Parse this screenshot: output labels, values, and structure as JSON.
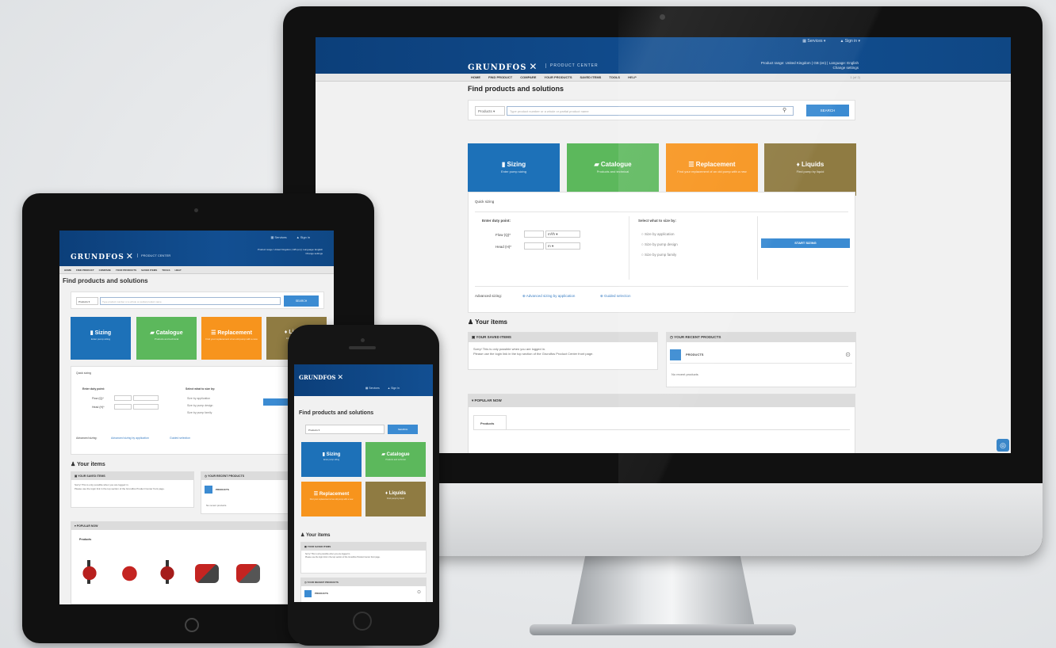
{
  "brand": {
    "logo": "GRUNDFOS",
    "logo_mark": "✕",
    "product_center": "PRODUCT CENTER"
  },
  "header": {
    "services": "Services",
    "sign_in": "Sign in",
    "range_line1": "Product range: United Kingdom | GB (en) | Language: English",
    "range_line2": "Change settings"
  },
  "nav": [
    "HOME",
    "FIND PRODUCT",
    "COMPARE",
    "YOUR PRODUCTS",
    "SAVED ITEMS",
    "TOOLS",
    "HELP"
  ],
  "nav_right": "1 (of 2)",
  "find": {
    "title": "Find products and solutions",
    "select_value": "Products",
    "placeholder": "Type product number or a whole or partial product name",
    "search_button": "SEARCH"
  },
  "tiles": [
    {
      "name": "Sizing",
      "icon": "ruler-icon",
      "sub": "Enter pump sizing",
      "color": "#1d71b8"
    },
    {
      "name": "Catalogue",
      "icon": "book-icon",
      "sub": "Products and technical",
      "color": "#5cb85c"
    },
    {
      "name": "Replacement",
      "icon": "swap-icon",
      "sub": "Find your replacement of an old pump with a new",
      "color": "#f7941d"
    },
    {
      "name": "Liquids",
      "icon": "drop-icon",
      "sub": "Find pump by liquid",
      "color": "#8f7b42"
    }
  ],
  "quick": {
    "title": "Quick sizing",
    "duty_title": "Enter duty point:",
    "flow_label": "Flow (Q)*",
    "head_label": "Head (H)*",
    "flow_unit": "m³/h",
    "head_unit": "m",
    "select_title": "Select what to size by:",
    "opt1": "Size by application",
    "opt2": "Size by pump design",
    "opt3": "Size by pump family",
    "start_button": "START SIZING",
    "advanced_label": "Advanced sizing:",
    "advanced_link1": "Advanced sizing by application",
    "advanced_link2": "Guided selection"
  },
  "your_items": {
    "title": "Your items",
    "saved_title": "YOUR SAVED ITEMS",
    "saved_text1": "Sorry! This is only possible when you are logged in.",
    "saved_text2": "Please use the login link in the top section of the Grundfos Product Center front page.",
    "recent_title": "YOUR RECENT PRODUCTS",
    "products_label": "PRODUCTS",
    "no_recent": "No recent products",
    "popular_title": "POPULAR NOW",
    "popular_tab": "Products"
  },
  "colors": {
    "header_blue": "#124f92",
    "accent_blue": "#3b8bd2",
    "sizing": "#1d71b8",
    "catalogue": "#5cb85c",
    "replacement": "#f7941d",
    "liquids": "#8f7b42"
  }
}
